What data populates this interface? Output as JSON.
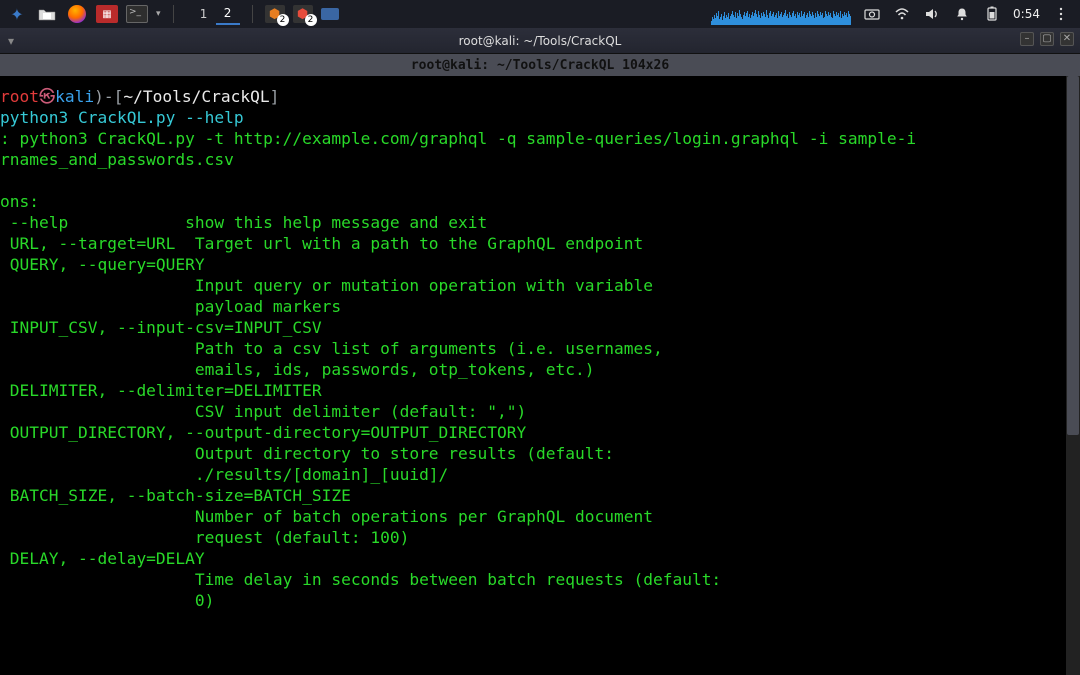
{
  "taskbar": {
    "workspaces": [
      "1",
      "2"
    ],
    "active_workspace": 1,
    "badge_left_count": "2",
    "badge_right_count": "2",
    "clock": "0:54"
  },
  "window": {
    "title": "root@kali: ~/Tools/CrackQL"
  },
  "tabbar": {
    "title": "root@kali: ~/Tools/CrackQL 104x26"
  },
  "prompt": {
    "user": "root",
    "sep": "㉿",
    "host": "kali",
    "path": "~/Tools/CrackQL",
    "command": "python3 CrackQL.py --help"
  },
  "output": {
    "usage1": ": python3 CrackQL.py -t http://example.com/graphql -q sample-queries/login.graphql -i sample-i",
    "usage2": "rnames_and_passwords.csv",
    "opts_hdr": "ons:",
    "lines": [
      " --help            show this help message and exit",
      " URL, --target=URL  Target url with a path to the GraphQL endpoint",
      " QUERY, --query=QUERY",
      "                    Input query or mutation operation with variable",
      "                    payload markers",
      " INPUT_CSV, --input-csv=INPUT_CSV",
      "                    Path to a csv list of arguments (i.e. usernames,",
      "                    emails, ids, passwords, otp_tokens, etc.)",
      " DELIMITER, --delimiter=DELIMITER",
      "                    CSV input delimiter (default: \",\")",
      " OUTPUT_DIRECTORY, --output-directory=OUTPUT_DIRECTORY",
      "                    Output directory to store results (default:",
      "                    ./results/[domain]_[uuid]/",
      " BATCH_SIZE, --batch-size=BATCH_SIZE",
      "                    Number of batch operations per GraphQL document",
      "                    request (default: 100)",
      " DELAY, --delay=DELAY",
      "                    Time delay in seconds between batch requests (default:",
      "                    0)"
    ]
  },
  "graph_heights": [
    4,
    8,
    6,
    10,
    7,
    12,
    9,
    14,
    6,
    8,
    11,
    5,
    9,
    13,
    7,
    10,
    8,
    12,
    6,
    9,
    11,
    14,
    10,
    8,
    13,
    7,
    12,
    9,
    15,
    11,
    8,
    6,
    10,
    13,
    9,
    12,
    14,
    8,
    11,
    7,
    10,
    13,
    9,
    12,
    15,
    11,
    8,
    14,
    10,
    7,
    12,
    9,
    13,
    11,
    8,
    15,
    10,
    7,
    12,
    14,
    9,
    11,
    13,
    8,
    10,
    12,
    7,
    14,
    9,
    11,
    13,
    8,
    10,
    12,
    15,
    9,
    11,
    7,
    13,
    10,
    8,
    12,
    14,
    9,
    11,
    7,
    13,
    10,
    12,
    8,
    14,
    9,
    11,
    13,
    7,
    10,
    12,
    8,
    14,
    11,
    9,
    13,
    10,
    7,
    12,
    8,
    14,
    11,
    9,
    13,
    10,
    12,
    7,
    8,
    14,
    11,
    9,
    13,
    10,
    12,
    8,
    7,
    14,
    11,
    9,
    13,
    10,
    12,
    8,
    14,
    7,
    11,
    9,
    13,
    10,
    12,
    8,
    14,
    11,
    9
  ]
}
